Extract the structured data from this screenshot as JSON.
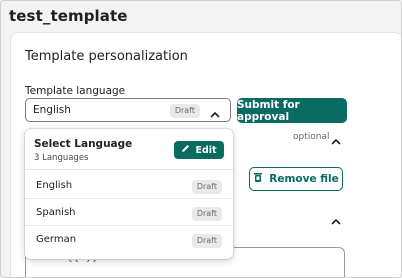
{
  "page": {
    "title": "test_template"
  },
  "section": {
    "title": "Template personalization"
  },
  "language_field": {
    "label": "Template language",
    "selected": "English",
    "selected_status": "Draft"
  },
  "actions": {
    "submit_label": "Submit for approval",
    "remove_file_label": "Remove file"
  },
  "optional_label": "optional",
  "dropdown": {
    "title": "Select Language",
    "subtitle": "3 Languages",
    "edit_label": "Edit",
    "items": [
      {
        "label": "English",
        "status": "Draft"
      },
      {
        "label": "Spanish",
        "status": "Draft"
      },
      {
        "label": "German",
        "status": "Draft"
      }
    ]
  },
  "body_text": "Hello {{1}}!",
  "colors": {
    "primary": "#0a6b63",
    "badge_bg": "#e9e9e9"
  },
  "icons": [
    "chevron-up-icon",
    "pencil-icon",
    "trash-icon"
  ]
}
